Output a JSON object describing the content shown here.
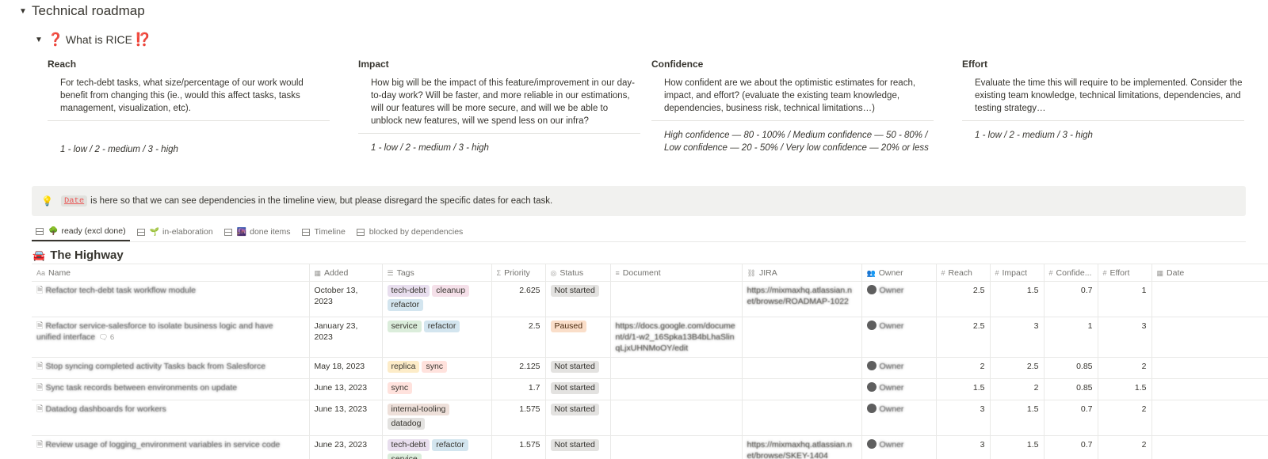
{
  "page": {
    "title": "Technical roadmap",
    "rice_heading": "What is RICE",
    "rice_heading_prefix": "❓",
    "rice_heading_suffix": "⁉️"
  },
  "rice": {
    "reach": {
      "title": "Reach",
      "description": "For tech-debt tasks, what size/percentage of our work would benefit from changing this (ie., would this affect tasks, tasks management, visualization, etc).",
      "scale": "1 - low / 2 - medium / 3 - high"
    },
    "impact": {
      "title": "Impact",
      "description": "How big will be the impact of this feature/improvement in our day-to-day work? Will be faster, and more reliable in our estimations, will our features will be more secure, and will we be able to unblock new features, will we spend less on our infra?",
      "scale": "1 - low / 2 - medium / 3 - high"
    },
    "confidence": {
      "title": "Confidence",
      "description": "How confident are we about the optimistic estimates for reach, impact, and effort? (evaluate the existing team knowledge, dependencies, business risk, technical limitations…)",
      "scale": "High confidence — 80 - 100% / Medium confidence — 50 - 80% / Low confidence — 20 - 50% / Very low confidence — 20% or less"
    },
    "effort": {
      "title": "Effort",
      "description": "Evaluate the time this will require to be implemented. Consider the existing team knowledge, technical limitations, dependencies, and testing strategy…",
      "scale": "1 - low / 2 - medium / 3 - high"
    }
  },
  "callout": {
    "icon": "lightbulb-icon",
    "code": "Date",
    "text": "is here so that we can see dependencies in the timeline view, but please disregard the specific dates for each task."
  },
  "views": [
    {
      "label": "ready (excl done)",
      "emoji": "🌳",
      "active": true
    },
    {
      "label": "in-elaboration",
      "emoji": "🌱",
      "active": false
    },
    {
      "label": "done items",
      "emoji": "🌆",
      "active": false
    },
    {
      "label": "Timeline",
      "emoji": "",
      "active": false
    },
    {
      "label": "blocked by dependencies",
      "emoji": "",
      "active": false
    }
  ],
  "database": {
    "title": "The Highway",
    "emoji": "🚘"
  },
  "columns": {
    "name": "Name",
    "added": "Added",
    "tags": "Tags",
    "priority": "Priority",
    "status": "Status",
    "document": "Document",
    "jira": "JIRA",
    "owner": "Owner",
    "reach": "Reach",
    "impact": "Impact",
    "confidence": "Confide...",
    "effort": "Effort",
    "date": "Date"
  },
  "colors": {
    "tag_tech_debt_bg": "#e8deee",
    "tag_cleanup_bg": "#f5e0e9",
    "tag_refactor_bg": "#d3e5ef",
    "tag_service_bg": "#dbeddb",
    "tag_replica_bg": "#fdecc8",
    "tag_sync_bg": "#ffe2dd",
    "tag_internal_tooling_bg": "#eee0da",
    "tag_datadog_bg": "#e3e2e0",
    "status_paused_bg": "#fadec9"
  },
  "rows": [
    {
      "name": "Refactor tech-debt task workflow module",
      "added_line1": "October 13,",
      "added_line2": "2023",
      "tags": [
        "tech-debt",
        "cleanup",
        "refactor"
      ],
      "priority": "2.625",
      "status": "Not started",
      "document": "",
      "jira": "https://mixmaxhq.atlassian.net/browse/ROADMAP-1022",
      "owner": "Owner",
      "reach": "2.5",
      "impact": "1.5",
      "confidence": "0.7",
      "effort": "1"
    },
    {
      "name": "Refactor service-salesforce to isolate business logic and have",
      "name2": "unified interface",
      "comments": "6",
      "added_line1": "January 23, 2023",
      "added_line2": "",
      "tags": [
        "service",
        "refactor"
      ],
      "priority": "2.5",
      "status": "Paused",
      "document": "https://docs.google.com/document/d/1-w2_16Spka13B4bLhaSlinqLjxUHNMoOY/edit",
      "jira": "",
      "owner": "Owner",
      "reach": "2.5",
      "impact": "3",
      "confidence": "1",
      "effort": "3"
    },
    {
      "name": "Stop syncing completed activity Tasks back from Salesforce",
      "added_line1": "May 18, 2023",
      "added_line2": "",
      "tags": [
        "replica",
        "sync"
      ],
      "priority": "2.125",
      "status": "Not started",
      "document": "",
      "jira": "",
      "owner": "Owner",
      "reach": "2",
      "impact": "2.5",
      "confidence": "0.85",
      "effort": "2"
    },
    {
      "name": "Sync task records between environments on update",
      "added_line1": "June 13, 2023",
      "added_line2": "",
      "tags": [
        "sync"
      ],
      "priority": "1.7",
      "status": "Not started",
      "document": "",
      "jira": "",
      "owner": "Owner",
      "reach": "1.5",
      "impact": "2",
      "confidence": "0.85",
      "effort": "1.5"
    },
    {
      "name": "Datadog dashboards for workers",
      "added_line1": "June 13, 2023",
      "added_line2": "",
      "tags": [
        "internal-tooling",
        "datadog"
      ],
      "priority": "1.575",
      "status": "Not started",
      "document": "",
      "jira": "",
      "owner": "Owner",
      "reach": "3",
      "impact": "1.5",
      "confidence": "0.7",
      "effort": "2"
    },
    {
      "name": "Review usage of logging_environment variables in service code",
      "added_line1": "June 23, 2023",
      "added_line2": "",
      "tags": [
        "tech-debt",
        "refactor",
        "service"
      ],
      "priority": "1.575",
      "status": "Not started",
      "document": "",
      "jira": "https://mixmaxhq.atlassian.net/browse/SKEY-1404",
      "owner": "Owner",
      "reach": "3",
      "impact": "1.5",
      "confidence": "0.7",
      "effort": "2"
    }
  ]
}
